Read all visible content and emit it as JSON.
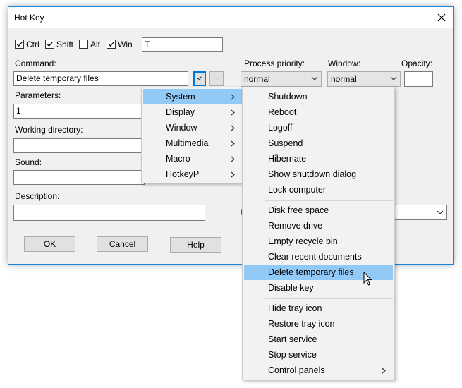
{
  "window": {
    "title": "Hot Key"
  },
  "modifiers": [
    {
      "label": "Ctrl",
      "checked": true
    },
    {
      "label": "Shift",
      "checked": true
    },
    {
      "label": "Alt",
      "checked": false
    },
    {
      "label": "Win",
      "checked": true
    }
  ],
  "key_field": {
    "value": "T"
  },
  "command": {
    "label": "Command:",
    "value": "Delete temporary files",
    "menu_button": "<",
    "browse_button": "..."
  },
  "process_priority": {
    "label": "Process priority:",
    "value": "normal"
  },
  "window_mode": {
    "label": "Window:",
    "value": "normal"
  },
  "opacity": {
    "label": "Opacity:",
    "value": ""
  },
  "parameters": {
    "label": "Parameters:",
    "value": "1"
  },
  "working_directory": {
    "label": "Working directory:",
    "value": ""
  },
  "sound": {
    "label": "Sound:",
    "value": ""
  },
  "description": {
    "label": "Description:",
    "value": ""
  },
  "buttons": {
    "ok": "OK",
    "cancel": "Cancel",
    "help": "Help"
  },
  "category_menu": {
    "items": [
      {
        "label": "System",
        "submenu": true,
        "highlighted": true
      },
      {
        "label": "Display",
        "submenu": true
      },
      {
        "label": "Window",
        "submenu": true
      },
      {
        "label": "Multimedia",
        "submenu": true
      },
      {
        "label": "Macro",
        "submenu": true
      },
      {
        "label": "HotkeyP",
        "submenu": true
      }
    ]
  },
  "system_menu": {
    "groups": [
      [
        "Shutdown",
        "Reboot",
        "Logoff",
        "Suspend",
        "Hibernate",
        "Show shutdown dialog",
        "Lock computer"
      ],
      [
        "Disk free space",
        "Remove drive",
        "Empty recycle bin",
        "Clear recent documents",
        "Delete temporary files",
        "Disable key"
      ],
      [
        "Hide tray icon",
        "Restore tray icon",
        "Start service",
        "Stop service",
        "Control panels"
      ]
    ],
    "highlighted": "Delete temporary files",
    "submenu_item": "Control panels"
  },
  "colors": {
    "highlight": "#91c9f7",
    "window_border": "#1883d7",
    "active_button_border": "#0078d7"
  }
}
